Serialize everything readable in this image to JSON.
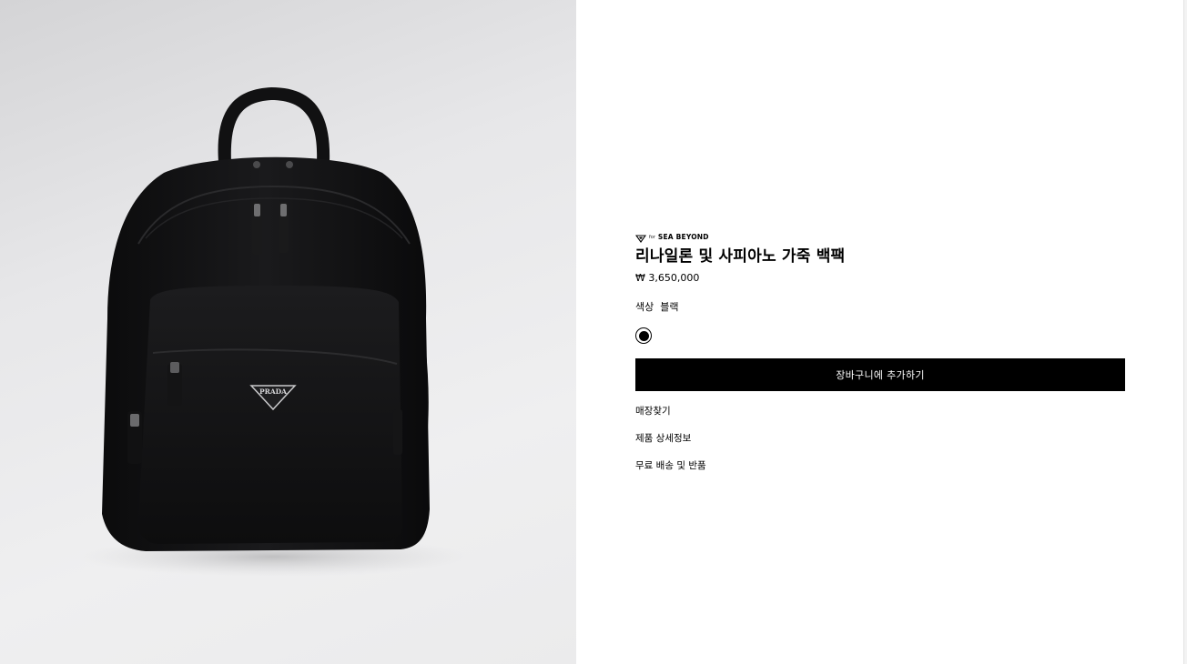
{
  "product": {
    "image_alt": "black nylon and leather backpack with triangle logo",
    "logo_text": "PRADA",
    "badge": {
      "icon": "triangle-heart-icon",
      "prefix": "for",
      "label": "SEA BEYOND"
    },
    "title": "리나일론 및 사피아노 가죽 백팩",
    "price": "₩ 3,650,000",
    "color_label": "색상",
    "color_value": "블랙",
    "swatches": [
      {
        "name": "블랙",
        "color": "#000000",
        "selected": true
      }
    ],
    "add_to_cart": "장바구니에 추가하기"
  },
  "links": {
    "store_finder": "매장찾기",
    "details": "제품 상세정보",
    "shipping": "무료 배송 및 반품"
  },
  "colors": {
    "button_bg": "#000000",
    "button_text": "#ffffff",
    "image_bg": "#e7e7e9"
  }
}
